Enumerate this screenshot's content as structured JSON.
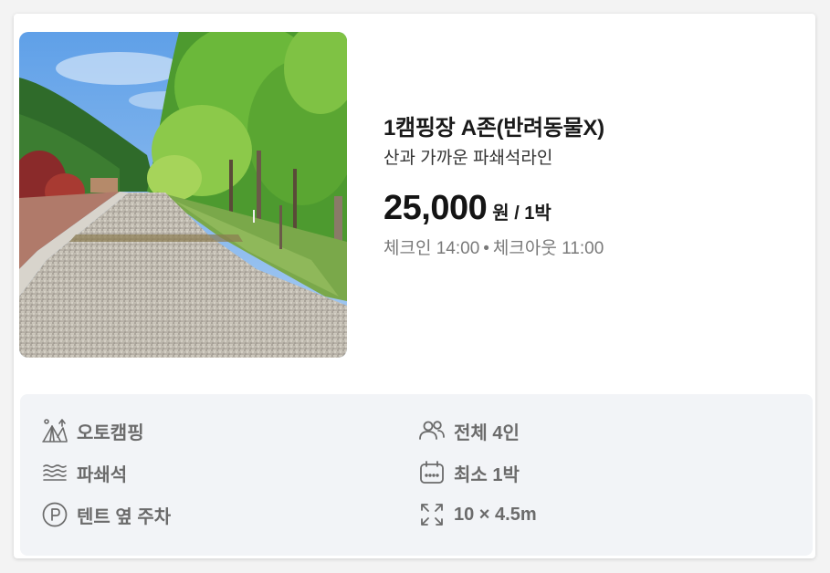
{
  "site": {
    "title": "1캠핑장 A존(반려동물X)",
    "subtitle": "산과 가까운 파쇄석라인",
    "price": "25,000",
    "price_unit": "원 / 1박",
    "checkin": "체크인 14:00",
    "separator": "•",
    "checkout": "체크아웃 11:00"
  },
  "features": [
    {
      "icon": "tent-camp-icon",
      "label": "오토캠핑"
    },
    {
      "icon": "users-icon",
      "label": "전체 4인"
    },
    {
      "icon": "gravel-waves-icon",
      "label": "파쇄석"
    },
    {
      "icon": "calendar-icon",
      "label": "최소 1박"
    },
    {
      "icon": "parking-icon",
      "label": "텐트 옆 주차"
    },
    {
      "icon": "expand-arrows-icon",
      "label": "10 × 4.5m"
    }
  ],
  "colors": {
    "text_primary": "#1a1a1a",
    "text_muted": "#7a7a7a",
    "feature_text": "#6b6b6b",
    "feature_bg": "#f2f4f7"
  }
}
